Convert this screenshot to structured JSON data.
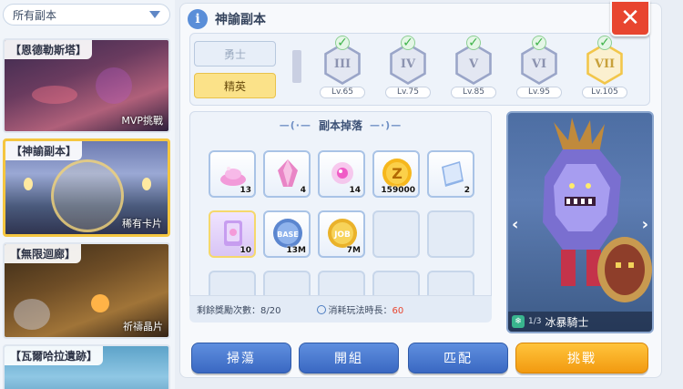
{
  "sidebar": {
    "dropdown_label": "所有副本",
    "cards": [
      {
        "title": "【恩德勒斯塔】",
        "tag": "MVP挑戰"
      },
      {
        "title": "【神諭副本】",
        "tag": "稀有卡片"
      },
      {
        "title": "【無限迴廊】",
        "tag": "祈禱晶片"
      },
      {
        "title": "【瓦爾哈拉遺跡】",
        "tag": ""
      }
    ]
  },
  "header": {
    "title": "神諭副本",
    "info_icon": "i",
    "close_icon": "✕"
  },
  "modes": [
    {
      "label": "勇士",
      "selected": false
    },
    {
      "label": "精英",
      "selected": true
    }
  ],
  "tiers": [
    {
      "numeral": "III",
      "level": "Lv.65",
      "cleared": true
    },
    {
      "numeral": "IV",
      "level": "Lv.75",
      "cleared": true
    },
    {
      "numeral": "V",
      "level": "Lv.85",
      "cleared": true
    },
    {
      "numeral": "VI",
      "level": "Lv.95",
      "cleared": true
    },
    {
      "numeral": "VII",
      "level": "Lv.105",
      "cleared": true
    }
  ],
  "drops": {
    "title": "副本掉落",
    "items": [
      {
        "icon": "pink-powder-icon",
        "qty": "13"
      },
      {
        "icon": "pink-crystal-icon",
        "qty": "4"
      },
      {
        "icon": "pink-orb-icon",
        "qty": "14"
      },
      {
        "icon": "zeny-coin-icon",
        "qty": "159000",
        "coin_label": "Z"
      },
      {
        "icon": "blue-book-icon",
        "qty": "2"
      },
      {
        "icon": "purple-card-icon",
        "qty": "10"
      },
      {
        "icon": "base-exp-icon",
        "qty": "13M",
        "coin_label": "BASE"
      },
      {
        "icon": "job-exp-icon",
        "qty": "7M",
        "coin_label": "JOB"
      }
    ],
    "remaining_label": "剩餘獎勵次數：",
    "remaining_value": "8/20",
    "cost_label": "消耗玩法時長：",
    "cost_value": "60"
  },
  "boss": {
    "name": "冰暴騎士",
    "page": "1/3",
    "prev": "‹",
    "next": "›"
  },
  "buttons": {
    "sweep": "掃蕩",
    "team": "開組",
    "match": "匹配",
    "challenge": "挑戰"
  },
  "colors": {
    "accent_orange": "#f29a10",
    "accent_blue": "#3a68c2",
    "close_red": "#e8452f",
    "check_green": "#3fb34a"
  }
}
